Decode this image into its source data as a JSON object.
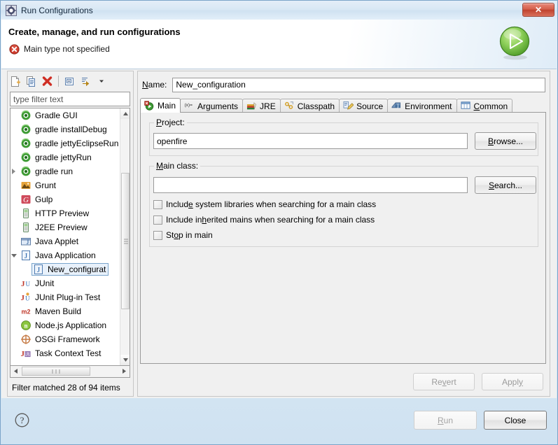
{
  "window": {
    "title": "Run Configurations",
    "title_icon": "gear-icon",
    "close_label": "✕"
  },
  "header": {
    "title": "Create, manage, and run configurations",
    "status_message": "Main type not specified",
    "status_icon": "error-icon",
    "run_icon": "run-play-icon"
  },
  "left_panel": {
    "toolbar": [
      {
        "name": "new-configuration-button",
        "icon": "new-document-icon"
      },
      {
        "name": "duplicate-configuration-button",
        "icon": "copy-icon"
      },
      {
        "name": "delete-configuration-button",
        "icon": "delete-x-icon"
      },
      {
        "name": "collapse-all-button",
        "icon": "collapse-all-icon"
      },
      {
        "name": "filter-button",
        "icon": "filter-icon"
      },
      {
        "name": "view-menu-button",
        "icon": "chevron-down-icon"
      }
    ],
    "filter": {
      "placeholder": "type filter text",
      "value": ""
    },
    "tree": [
      {
        "label": "Gradle GUI",
        "icon": "gradle-icon",
        "arrow": "none",
        "indent": 0,
        "selected": false
      },
      {
        "label": "gradle installDebug",
        "icon": "gradle-icon",
        "arrow": "none",
        "indent": 0,
        "selected": false
      },
      {
        "label": "gradle jettyEclipseRun",
        "icon": "gradle-icon",
        "arrow": "none",
        "indent": 0,
        "selected": false
      },
      {
        "label": "gradle jettyRun",
        "icon": "gradle-icon",
        "arrow": "none",
        "indent": 0,
        "selected": false
      },
      {
        "label": "gradle run",
        "icon": "gradle-icon",
        "arrow": "collapsed",
        "indent": 0,
        "selected": false
      },
      {
        "label": "Grunt",
        "icon": "grunt-icon",
        "arrow": "none",
        "indent": 0,
        "selected": false
      },
      {
        "label": "Gulp",
        "icon": "gulp-icon",
        "arrow": "none",
        "indent": 0,
        "selected": false
      },
      {
        "label": "HTTP Preview",
        "icon": "server-icon",
        "arrow": "none",
        "indent": 0,
        "selected": false
      },
      {
        "label": "J2EE Preview",
        "icon": "server-icon",
        "arrow": "none",
        "indent": 0,
        "selected": false
      },
      {
        "label": "Java Applet",
        "icon": "java-applet-icon",
        "arrow": "none",
        "indent": 0,
        "selected": false
      },
      {
        "label": "Java Application",
        "icon": "java-application-icon",
        "arrow": "expanded",
        "indent": 0,
        "selected": false
      },
      {
        "label": "New_configurat",
        "icon": "java-application-icon",
        "arrow": "none",
        "indent": 1,
        "selected": true
      },
      {
        "label": "JUnit",
        "icon": "junit-icon",
        "arrow": "none",
        "indent": 0,
        "selected": false
      },
      {
        "label": "JUnit Plug-in Test",
        "icon": "junit-plugin-icon",
        "arrow": "none",
        "indent": 0,
        "selected": false
      },
      {
        "label": "Maven Build",
        "icon": "maven-icon",
        "arrow": "none",
        "indent": 0,
        "selected": false
      },
      {
        "label": "Node.js Application",
        "icon": "nodejs-icon",
        "arrow": "none",
        "indent": 0,
        "selected": false
      },
      {
        "label": "OSGi Framework",
        "icon": "osgi-icon",
        "arrow": "none",
        "indent": 0,
        "selected": false
      },
      {
        "label": "Task Context Test",
        "icon": "junit-task-icon",
        "arrow": "none",
        "indent": 0,
        "selected": false
      }
    ],
    "status_text": "Filter matched 28 of 94 items"
  },
  "right_panel": {
    "name_label": "Name:",
    "name_accesskey": "N",
    "name_value": "New_configuration",
    "tabs": [
      {
        "label": "Main",
        "icon": "main-tab-icon",
        "active": true
      },
      {
        "label": "Arguments",
        "icon": "arguments-tab-icon",
        "active": false
      },
      {
        "label": "JRE",
        "icon": "jre-tab-icon",
        "active": false
      },
      {
        "label": "Classpath",
        "icon": "classpath-tab-icon",
        "active": false
      },
      {
        "label": "Source",
        "icon": "source-tab-icon",
        "active": false
      },
      {
        "label": "Environment",
        "icon": "environment-tab-icon",
        "active": false
      },
      {
        "label": "Common",
        "icon": "common-tab-icon",
        "active": false,
        "accesskey": "C"
      }
    ],
    "main_tab": {
      "project_label": "Project:",
      "project_accesskey": "P",
      "project_value": "openfire",
      "browse_label": "Browse...",
      "browse_accesskey": "B",
      "main_class_label": "Main class:",
      "main_class_accesskey": "M",
      "main_class_value": "",
      "search_label": "Search...",
      "search_accesskey": "S",
      "checkboxes": [
        {
          "label": "Include system libraries when searching for a main class",
          "checked": false,
          "accesskey": "e"
        },
        {
          "label": "Include inherited mains when searching for a main class",
          "checked": false,
          "accesskey": "h"
        },
        {
          "label": "Stop in main",
          "checked": false,
          "accesskey": "o"
        }
      ]
    },
    "revert_label": "Revert",
    "apply_label": "Apply"
  },
  "footer": {
    "help_icon": "help-question-icon",
    "run_label": "Run",
    "run_accesskey": "R",
    "close_label": "Close"
  },
  "colors": {
    "titlebar_start": "#e4eef8",
    "titlebar_end": "#e2eef9",
    "close_button": "#c0432f",
    "error_red": "#c0392b",
    "run_green": "#6cbb3c",
    "selection_blue": "#7aa5cc",
    "selection_fill": "#e8f1fb",
    "gradle_green": "#3f9c35",
    "desktop_blue": "#b9d4ea"
  }
}
